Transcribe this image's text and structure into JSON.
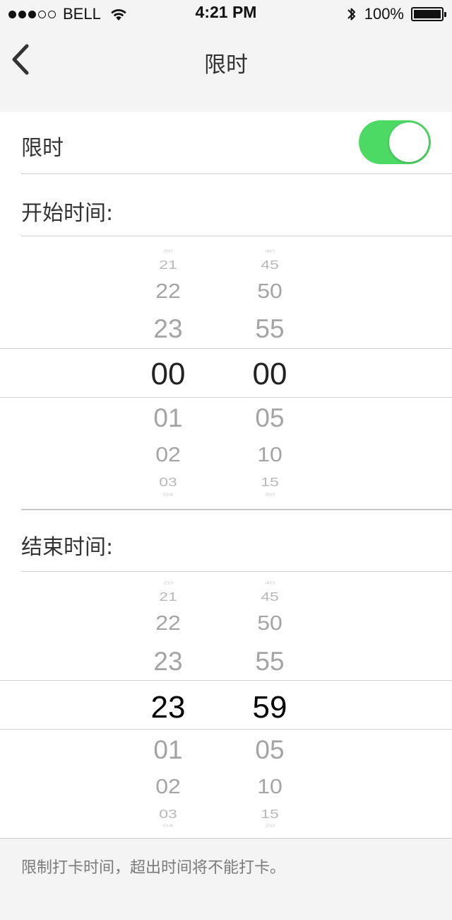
{
  "status_bar": {
    "carrier": "BELL",
    "time": "4:21 PM",
    "battery": "100%",
    "signal_dots_filled": 3,
    "signal_dots_total": 5
  },
  "nav": {
    "title": "限时",
    "back_icon": "chevron-left-icon"
  },
  "toggle_row": {
    "label": "限时",
    "enabled": true,
    "color": "#4cd964"
  },
  "start": {
    "label": "开始时间:",
    "hours": [
      "20",
      "21",
      "22",
      "23",
      "00",
      "01",
      "02",
      "03",
      "04"
    ],
    "minutes": [
      "40",
      "45",
      "50",
      "55",
      "00",
      "05",
      "10",
      "15",
      "20"
    ]
  },
  "end": {
    "label": "结束时间:",
    "hours": [
      "20",
      "21",
      "22",
      "23",
      "23",
      "01",
      "02",
      "03",
      "04"
    ],
    "minutes": [
      "40",
      "45",
      "50",
      "55",
      "59",
      "05",
      "10",
      "15",
      "20"
    ]
  },
  "footer": {
    "note": "限制打卡时间，超出时间将不能打卡。"
  }
}
